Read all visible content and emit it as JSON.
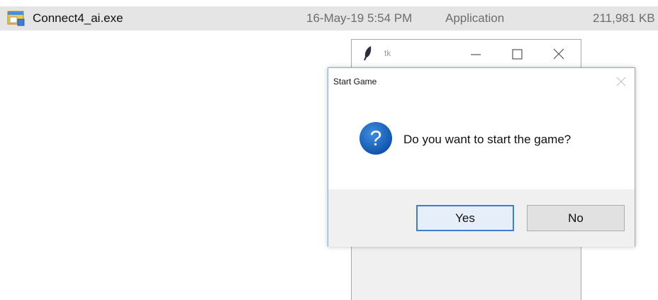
{
  "file_row": {
    "name": "Connect4_ai.exe",
    "date": "16-May-19 5:54 PM",
    "type": "Application",
    "size": "211,981 KB",
    "icon": "application-icon"
  },
  "tk_window": {
    "title": "tk",
    "icon": "feather-icon"
  },
  "dialog": {
    "title": "Start Game",
    "message": "Do you want to start the game?",
    "icon": "question-icon",
    "buttons": {
      "yes": "Yes",
      "no": "No"
    }
  },
  "colors": {
    "selection_row": "#e5e5e5",
    "question_blue": "#1565c0",
    "focus_border": "#3c7fd1"
  }
}
